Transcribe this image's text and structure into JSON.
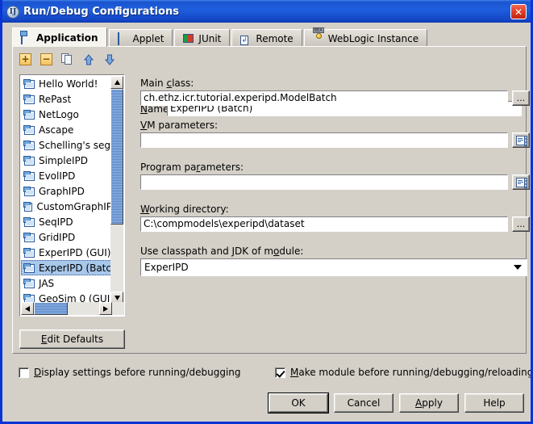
{
  "window": {
    "title": "Run/Debug Configurations",
    "icon": "idea-logo-icon",
    "close_label": "✕",
    "frame_color": "#0a34d6",
    "titlebar_color": "#1a55d0",
    "face_color": "#d4d0c8"
  },
  "tabs": [
    {
      "label": "Application",
      "icon": "application-window-icon",
      "active": true
    },
    {
      "label": "Applet",
      "icon": "applet-window-icon",
      "active": false
    },
    {
      "label": "JUnit",
      "icon": "junit-icon",
      "active": false
    },
    {
      "label": "Remote",
      "icon": "remote-icon",
      "active": false
    },
    {
      "label": "WebLogic Instance",
      "icon": "weblogic-icon",
      "active": false
    }
  ],
  "toolbar": {
    "add_label": "+",
    "add_name": "add-configuration-button",
    "remove_label": "−",
    "remove_name": "remove-configuration-button",
    "copy_name": "copy-configuration-button",
    "move_up_name": "move-up-button",
    "move_down_name": "move-down-button"
  },
  "name_field": {
    "label": "Name:",
    "mnemonic": "N",
    "value": "ExperIPD (Batch)"
  },
  "config_list": {
    "items": [
      {
        "label": "Hello World!",
        "selected": false
      },
      {
        "label": "RePast",
        "selected": false
      },
      {
        "label": "NetLogo",
        "selected": false
      },
      {
        "label": "Ascape",
        "selected": false
      },
      {
        "label": "Schelling's seg",
        "selected": false
      },
      {
        "label": "SimpleIPD",
        "selected": false
      },
      {
        "label": "EvolIPD",
        "selected": false
      },
      {
        "label": "GraphIPD",
        "selected": false
      },
      {
        "label": "CustomGraphIP",
        "selected": false
      },
      {
        "label": "SeqIPD",
        "selected": false
      },
      {
        "label": "GridIPD",
        "selected": false
      },
      {
        "label": "ExperIPD (GUI)",
        "selected": false
      },
      {
        "label": "ExperIPD (Batc",
        "selected": true
      },
      {
        "label": "JAS",
        "selected": false
      },
      {
        "label": "GeoSim 0 (GUI",
        "selected": false
      }
    ],
    "selection_bg": "#a8c8ea",
    "scroll_up_glyph": "▲",
    "scroll_down_glyph": "▼",
    "scroll_left_glyph": "◀",
    "scroll_right_glyph": "▶"
  },
  "edit_defaults": {
    "label": "Edit Defaults",
    "mnemonic": "E"
  },
  "fields": {
    "main_class": {
      "label": "Main class:",
      "value": "ch.ethz.icr.tutorial.experipd.ModelBatch",
      "browse_label": "..."
    },
    "vm_parameters": {
      "label": "VM parameters:",
      "value": "",
      "expand_icon": "expand-editor-icon"
    },
    "program_parameters": {
      "label": "Program parameters:",
      "value": "",
      "expand_icon": "expand-editor-icon"
    },
    "working_directory": {
      "label": "Working directory:",
      "value": "C:\\compmodels\\experipd\\dataset",
      "browse_label": "..."
    },
    "module": {
      "label": "Use classpath and JDK of module:",
      "value": "ExperIPD"
    }
  },
  "options": {
    "display_settings": {
      "label": "Display settings before running/debugging",
      "checked": false
    },
    "make_module": {
      "label": "Make module before running/debugging/reloading",
      "checked": true
    }
  },
  "buttons": [
    {
      "label": "OK",
      "name": "ok-button",
      "default": true
    },
    {
      "label": "Cancel",
      "name": "cancel-button",
      "default": false
    },
    {
      "label": "Apply",
      "name": "apply-button",
      "default": false
    },
    {
      "label": "Help",
      "name": "help-button",
      "default": false
    }
  ]
}
